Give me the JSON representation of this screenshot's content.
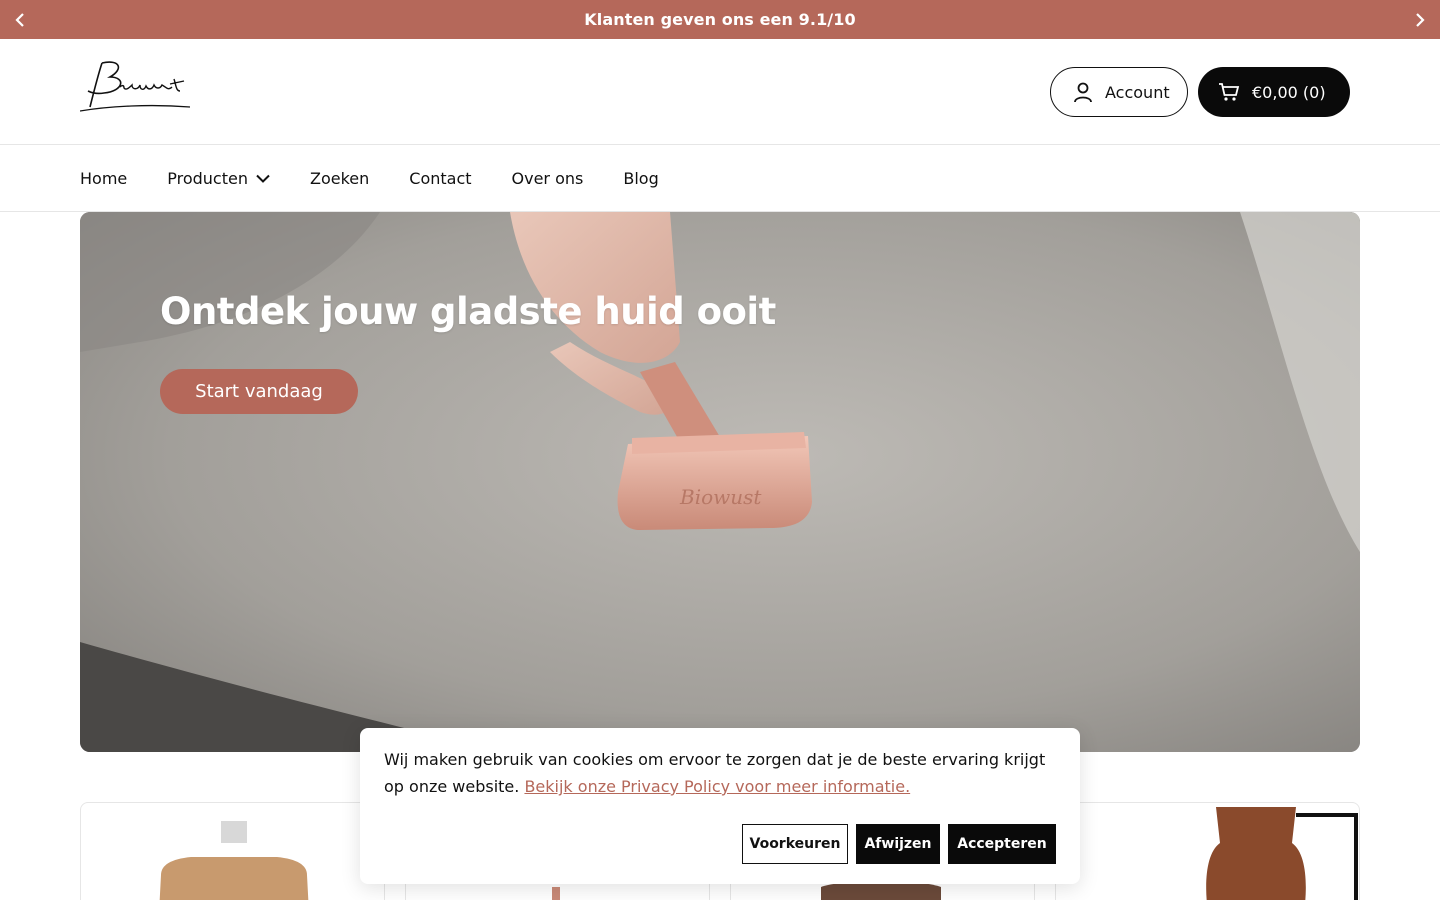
{
  "announcement": {
    "message": "Klanten geven ons een 9.1/10",
    "prev_icon": "chevron-left-icon",
    "next_icon": "chevron-right-icon"
  },
  "header": {
    "logo_text": "Biowust",
    "account_label": "Account",
    "cart_label": "€0,00 (0)"
  },
  "nav": {
    "items": [
      "Home",
      "Producten",
      "Zoeken",
      "Contact",
      "Over ons",
      "Blog"
    ]
  },
  "hero": {
    "title": "Ontdek jouw gladste huid ooit",
    "button_label": "Start vandaag"
  },
  "cookie": {
    "text": "Wij maken gebruik van cookies om ervoor te zorgen dat je de beste ervaring krijgt op onze website.",
    "link_text": "Bekijk onze Privacy Policy voor meer informatie.",
    "preferences_label": "Voorkeuren",
    "reject_label": "Afwijzen",
    "accept_label": "Accepteren"
  },
  "colors": {
    "accent": "#b5685a",
    "dark": "#0a0a0a"
  }
}
